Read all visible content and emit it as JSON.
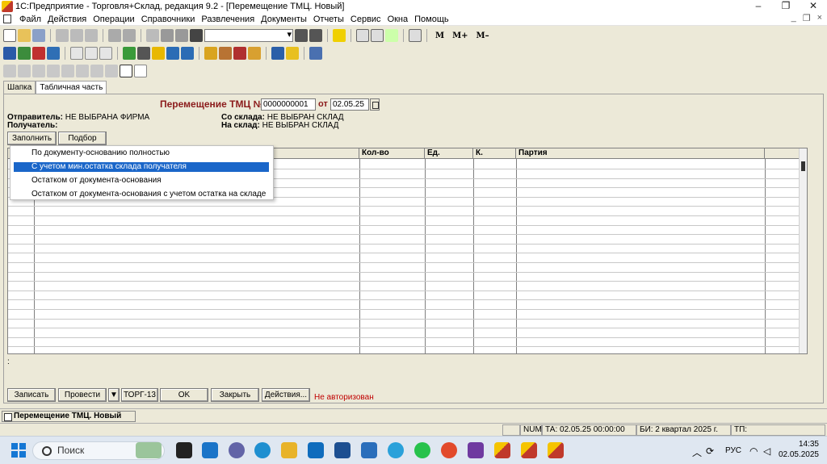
{
  "window": {
    "title": "1С:Предприятие - Торговля+Склад, редакция 9.2 - [Перемещение ТМЦ. Новый]",
    "controls": [
      "–",
      "❐",
      "✕"
    ],
    "mdi_controls": [
      "_",
      "❐",
      "×"
    ]
  },
  "menu": {
    "items": [
      "Файл",
      "Действия",
      "Операции",
      "Справочники",
      "Развлечения",
      "Документы",
      "Отчеты",
      "Сервис",
      "Окна",
      "Помощь"
    ]
  },
  "toolbar": {
    "text_buttons": [
      "M",
      "M+",
      "M–"
    ]
  },
  "tabs": [
    "Шапка",
    "Табличная часть"
  ],
  "doc": {
    "heading": "Перемещение ТМЦ №",
    "number": "0000000001",
    "ot_label": "от",
    "date": "02.05.25"
  },
  "info": {
    "sender_label": "Отправитель:",
    "sender_value": "НЕ ВЫБРАНА ФИРМА",
    "receiver_label": "Получатель:",
    "from_wh_label": "Со склада:",
    "from_wh_value": "НЕ ВЫБРАН СКЛАД",
    "to_wh_label": "На склад:",
    "to_wh_value": "НЕ ВЫБРАН СКЛАД"
  },
  "buttons": {
    "fill": "Заполнить",
    "pick": "Подбор",
    "save": "Записать",
    "post": "Провести",
    "post_arrow": "▼",
    "torg13": "ТОРГ-13",
    "ok": "OK",
    "close": "Закрыть",
    "actions": "Действия..."
  },
  "dropdown": {
    "items": [
      "По документу-основанию полностью",
      "С учетом мин.остатка склада получателя",
      "Остатком от документа-основания",
      "Остатком от документа-основания с учетом остатка на складе"
    ],
    "highlighted_index": 1
  },
  "grid": {
    "columns": [
      "Кол-во",
      "Ед.",
      "К.",
      "Партия"
    ]
  },
  "colon": ":",
  "not_authorized": "Не авторизован",
  "window_task": "Перемещение ТМЦ. Новый",
  "status": {
    "num": "NUM",
    "ta": "ТА: 02.05.25  00:00:00",
    "bi": "БИ: 2 квартал 2025 г.",
    "tp": "ТП:"
  },
  "taskbar": {
    "search_placeholder": "Поиск",
    "lang": "РУС",
    "time": "14:35",
    "date": "02.05.2025"
  }
}
